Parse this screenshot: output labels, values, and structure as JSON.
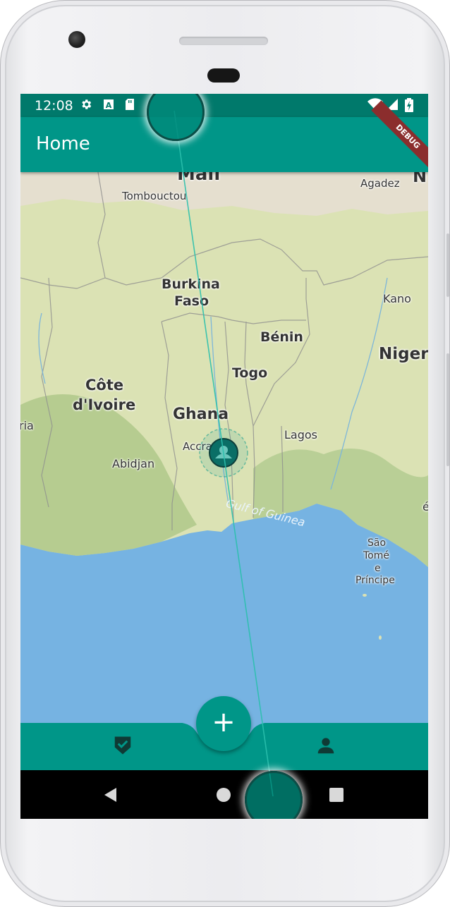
{
  "status_bar": {
    "time": "12:08"
  },
  "app_bar": {
    "title": "Home",
    "debug_banner": "DEBUG"
  },
  "map": {
    "labels": {
      "mali": "Mali",
      "tombouctou": "Tombouctou",
      "agadez": "Agadez",
      "niger_partial": "N",
      "burkina": "Burkina",
      "faso": "Faso",
      "kano": "Kano",
      "benin": "Bénin",
      "nigeria": "Nigeri",
      "togo": "Togo",
      "cote": "Côte",
      "divoire": "d'Ivoire",
      "ghana": "Ghana",
      "liberia_partial": "ria",
      "lagos": "Lagos",
      "accra": "Accra",
      "abidjan": "Abidjan",
      "gulf": "Gulf of Guinea",
      "sao": "São",
      "tome": "Tomé",
      "e": "e",
      "principe": "Príncipe",
      "edge_partial": "é"
    }
  },
  "bottom_nav": {
    "fab_label": "+"
  },
  "colors": {
    "primary": "#009688",
    "primary_dark": "#00796b",
    "water": "#76b3e2",
    "land": "#dbe2b6"
  }
}
